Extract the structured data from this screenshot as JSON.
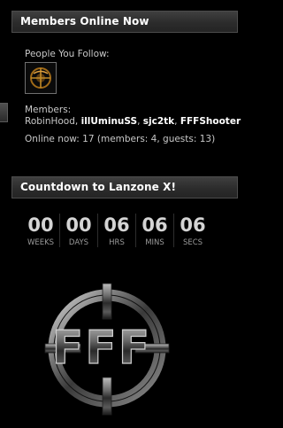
{
  "members_online": {
    "title": "Members Online Now",
    "people_you_follow_label": "People You Follow:",
    "members_label": "Members:",
    "members": [
      {
        "name": "RobinHood",
        "bold": false
      },
      {
        "name": "illUminuSS",
        "bold": true
      },
      {
        "name": "sjc2tk",
        "bold": true
      },
      {
        "name": "FFFShooter",
        "bold": true
      }
    ],
    "online_now": "Online now: 17 (members: 4, guests: 13)"
  },
  "countdown": {
    "title": "Countdown to Lanzone X!",
    "units": [
      {
        "value": "00",
        "label": "WEEKS"
      },
      {
        "value": "00",
        "label": "DAYS"
      },
      {
        "value": "06",
        "label": "HRS"
      },
      {
        "value": "06",
        "label": "MINS"
      },
      {
        "value": "06",
        "label": "SECS"
      }
    ]
  },
  "logo_text": "FFF"
}
